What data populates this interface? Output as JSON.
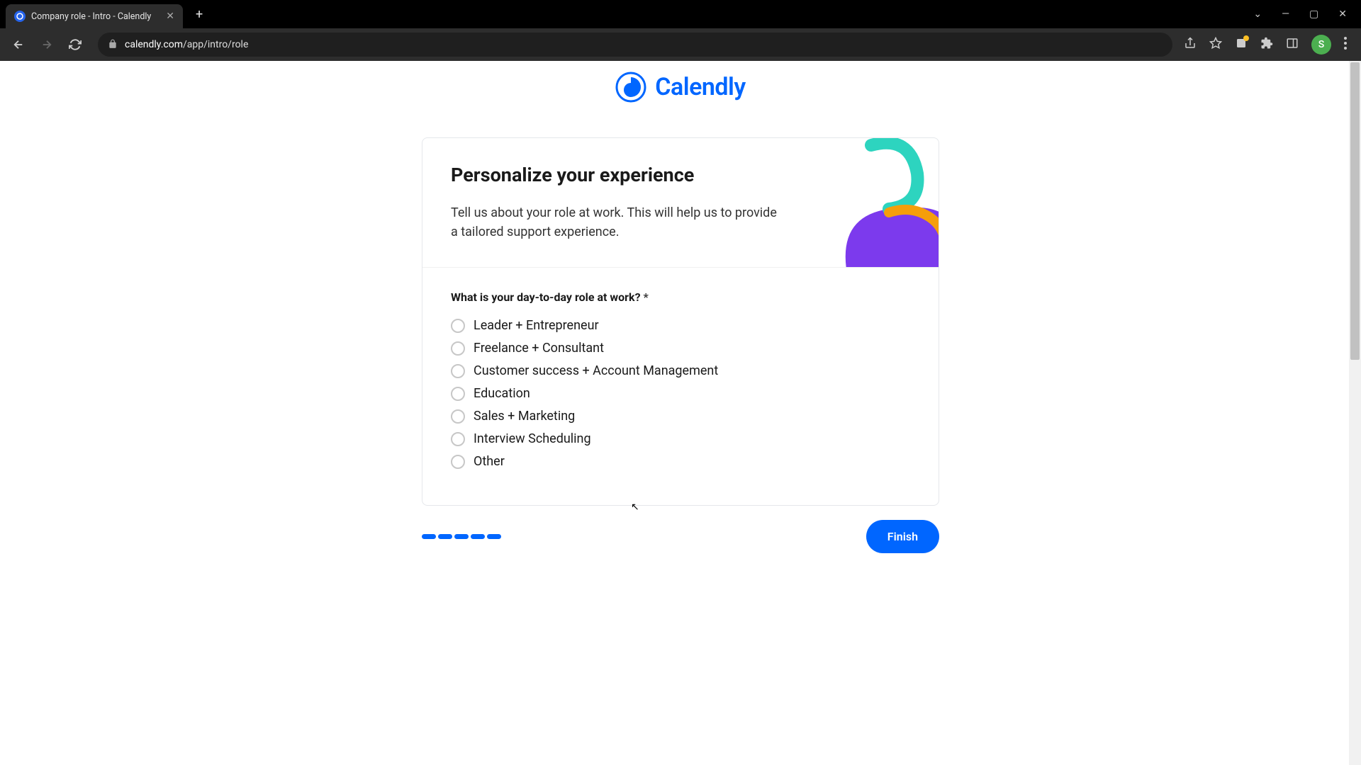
{
  "browser": {
    "tab_title": "Company role - Intro - Calendly",
    "url_host": "calendly.com",
    "url_path": "/app/intro/role",
    "avatar_initial": "S"
  },
  "logo_text": "Calendly",
  "card": {
    "title": "Personalize your experience",
    "subtitle": "Tell us about your role at work. This will help us to provide a tailored support experience."
  },
  "question": {
    "label": "What is your day-to-day role at work?",
    "required_marker": "*",
    "options": [
      "Leader + Entrepreneur",
      "Freelance + Consultant",
      "Customer success + Account Management",
      "Education",
      "Sales + Marketing",
      "Interview Scheduling",
      "Other"
    ]
  },
  "progress_steps": 5,
  "finish_label": "Finish"
}
